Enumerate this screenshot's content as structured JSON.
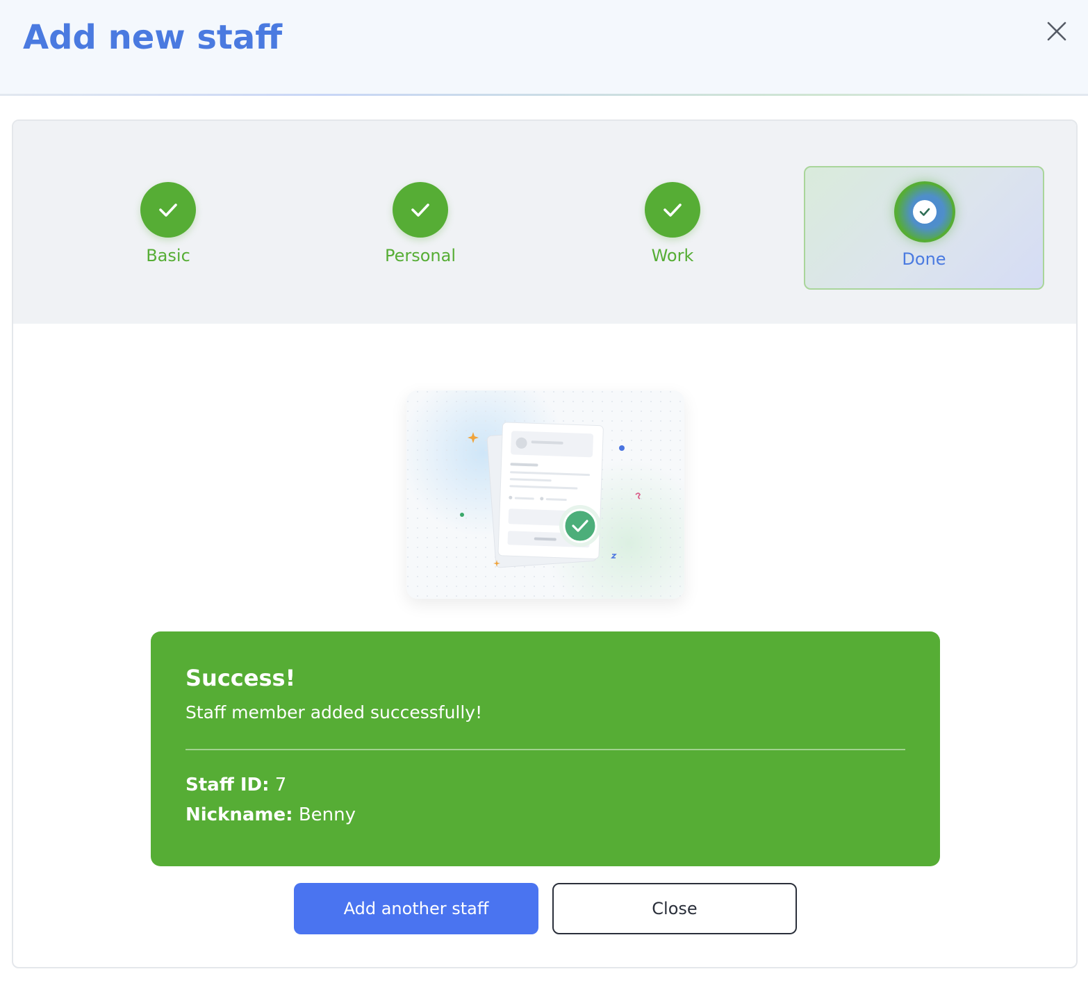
{
  "header": {
    "title": "Add new staff"
  },
  "steps": [
    {
      "label": "Basic",
      "status": "complete"
    },
    {
      "label": "Personal",
      "status": "complete"
    },
    {
      "label": "Work",
      "status": "complete"
    },
    {
      "label": "Done",
      "status": "current"
    }
  ],
  "success": {
    "title": "Success!",
    "message": "Staff member added successfully!",
    "staff_id_label": "Staff ID:",
    "staff_id_value": "7",
    "nickname_label": "Nickname:",
    "nickname_value": "Benny"
  },
  "actions": {
    "add_another_label": "Add another staff",
    "close_label": "Close"
  },
  "colors": {
    "accent_blue": "#4a7ae0",
    "success_green": "#56ad35",
    "primary_button": "#4a74f0"
  },
  "icons": {
    "close": "close-x-icon",
    "step_check": "checkmark-icon",
    "illustration": "document-success-illustration"
  }
}
